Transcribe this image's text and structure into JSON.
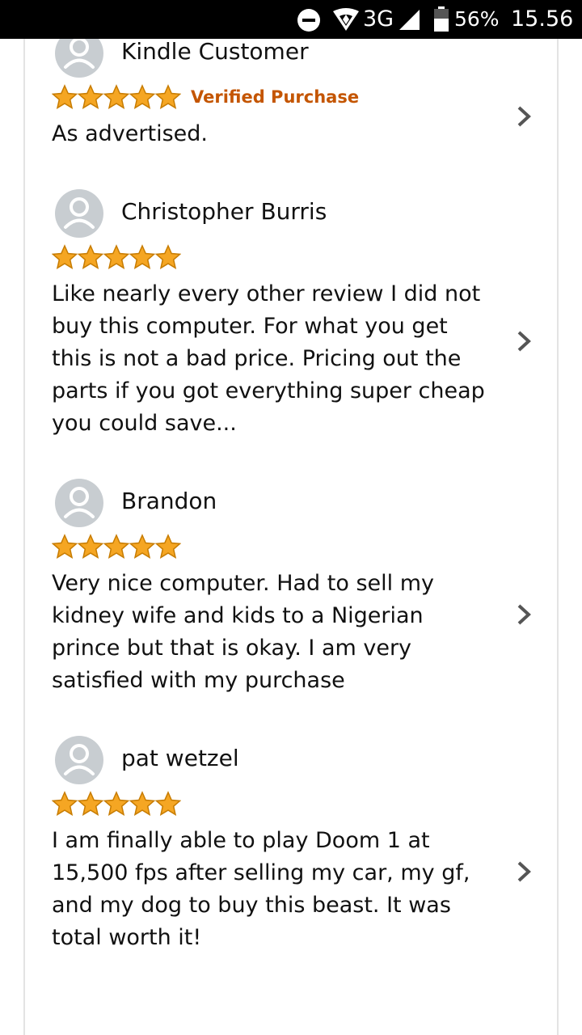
{
  "status_bar": {
    "network": "3G",
    "battery": "56%",
    "time": "15.56"
  },
  "reviews": [
    {
      "name": "Kindle Customer",
      "rating": 5,
      "verified": "Verified Purchase",
      "text": "As advertised."
    },
    {
      "name": "Christopher Burris",
      "rating": 5,
      "text": "Like nearly every other review I did not\nbuy this computer. For what you get\nthis is not a bad price. Pricing out the\nparts if you got everything super cheap\nyou could save..."
    },
    {
      "name": "Brandon",
      "rating": 5,
      "text": "Very nice computer. Had to sell my\nkidney wife and kids to a Nigerian\nprince but that is okay. I am very\nsatisfied with my purchase"
    },
    {
      "name": "pat wetzel",
      "rating": 5,
      "text": "I am finally able to play Doom 1 at\n15,500 fps after selling my car, my gf,\nand my dog to buy this beast. It was\ntotal worth it!"
    }
  ],
  "colors": {
    "star": "#f5a623",
    "star_outline": "#c77c02",
    "verified": "#c45500",
    "avatar": "#c8cdd1"
  }
}
